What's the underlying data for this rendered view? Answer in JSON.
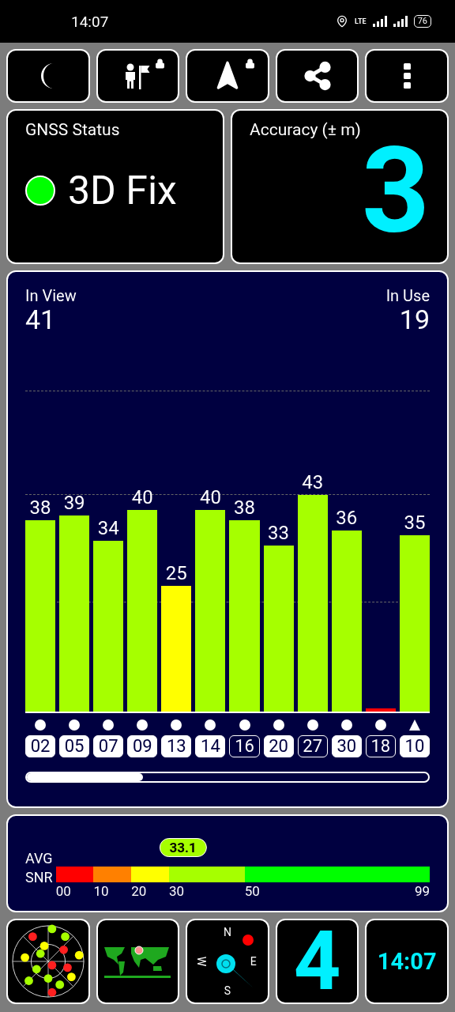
{
  "status_bar": {
    "time": "14:07",
    "battery": "76",
    "network": "LTE"
  },
  "toolbar": [
    {
      "kind": "moon",
      "locked": false
    },
    {
      "kind": "person-flag",
      "locked": true
    },
    {
      "kind": "arrow",
      "locked": true
    },
    {
      "kind": "share",
      "locked": false
    },
    {
      "kind": "more",
      "locked": false
    }
  ],
  "gnss_status": {
    "title": "GNSS Status",
    "fix": "3D Fix",
    "color": "#00ff00"
  },
  "accuracy": {
    "title": "Accuracy (± m)",
    "value": "3"
  },
  "sky": {
    "in_view_label": "In View",
    "in_view": "41",
    "in_use_label": "In Use",
    "in_use": "19",
    "satellites": [
      {
        "id": "02",
        "snr": "38",
        "color": "#a6ff00",
        "kind": "dot",
        "used": true
      },
      {
        "id": "05",
        "snr": "39",
        "color": "#a6ff00",
        "kind": "dot",
        "used": true
      },
      {
        "id": "07",
        "snr": "34",
        "color": "#a6ff00",
        "kind": "dot",
        "used": true
      },
      {
        "id": "09",
        "snr": "40",
        "color": "#a6ff00",
        "kind": "dot",
        "used": true
      },
      {
        "id": "13",
        "snr": "25",
        "color": "#ffff00",
        "kind": "dot",
        "used": true
      },
      {
        "id": "14",
        "snr": "40",
        "color": "#a6ff00",
        "kind": "dot",
        "used": true
      },
      {
        "id": "16",
        "snr": "38",
        "color": "#a6ff00",
        "kind": "dot",
        "used": false
      },
      {
        "id": "20",
        "snr": "33",
        "color": "#a6ff00",
        "kind": "dot",
        "used": true
      },
      {
        "id": "27",
        "snr": "43",
        "color": "#a6ff00",
        "kind": "dot",
        "used": false
      },
      {
        "id": "30",
        "snr": "36",
        "color": "#a6ff00",
        "kind": "dot",
        "used": true
      },
      {
        "id": "18",
        "color": "#ff0000",
        "kind": "dot",
        "used": false
      },
      {
        "id": "10",
        "snr": "35",
        "color": "#a6ff00",
        "kind": "triangle",
        "used": true
      }
    ]
  },
  "snr": {
    "label_top": "AVG",
    "label_bottom": "SNR",
    "value": "33.1",
    "level": 0.34,
    "segments": [
      {
        "color": "#ff0000"
      },
      {
        "color": "#ff8000"
      },
      {
        "color": "#ffff00"
      },
      {
        "color": "#a6ff00"
      },
      {
        "color": "#00ff00"
      }
    ],
    "ticks": [
      "00",
      "10",
      "20",
      "30",
      "50",
      "99"
    ]
  },
  "tiles": {
    "compass": [
      "N",
      "E",
      "S",
      "W"
    ],
    "count": "4",
    "time": "14:07"
  }
}
